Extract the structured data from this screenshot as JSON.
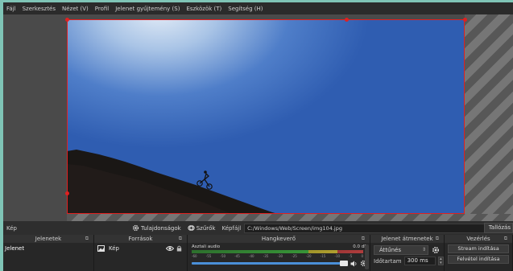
{
  "menubar": {
    "items": [
      "Fájl",
      "Szerkesztés",
      "Nézet (V)",
      "Profil",
      "Jelenet gyűjtemény (S)",
      "Eszközök (T)",
      "Segítség (H)"
    ]
  },
  "toolbar": {
    "source_name": "Kép",
    "properties_label": "Tulajdonságok",
    "filters_label": "Szűrők",
    "file_label": "Képfájl",
    "file_path": "C:/Windows/Web/Screen/img104.jpg",
    "browse_label": "Tallózás"
  },
  "docks": {
    "scenes": {
      "title": "Jelenetek",
      "items": [
        "Jelenet"
      ]
    },
    "sources": {
      "title": "Források",
      "items": [
        {
          "label": "Kép",
          "icon": "image-icon"
        }
      ]
    },
    "mixer": {
      "title": "Hangkeverő",
      "channel_name": "Asztali audio",
      "level": "0.0 dB",
      "ticks": [
        "-60",
        "-55",
        "-50",
        "-45",
        "-40",
        "-35",
        "-30",
        "-25",
        "-20",
        "-15",
        "-10",
        "-5",
        "0"
      ]
    },
    "transitions": {
      "title": "Jelenet átmenetek",
      "selected": "Áttűnés",
      "duration_label": "Időtartam",
      "duration_value": "300 ms"
    },
    "controls": {
      "title": "Vezérlés",
      "buttons": [
        "Stream indítása",
        "Felvétel indítása"
      ]
    }
  },
  "colors": {
    "accent_frame": "#7fc4b6",
    "selection_red": "#e02020",
    "sky_blue": "#2f5db1",
    "slider_blue": "#4a8fd8"
  }
}
